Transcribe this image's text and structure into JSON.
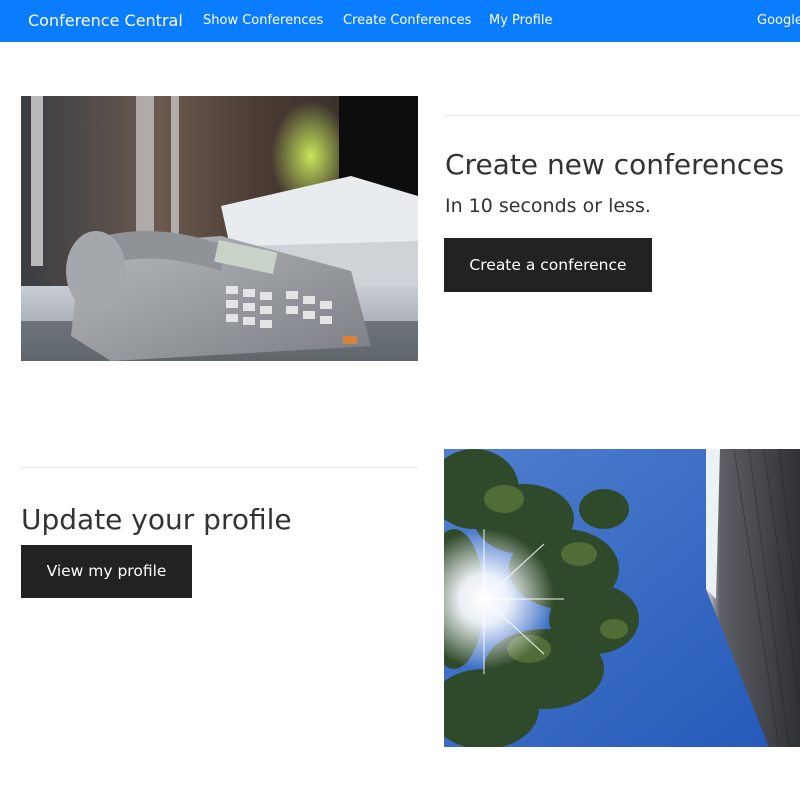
{
  "navbar": {
    "brand": "Conference Central",
    "links": [
      "Show Conferences",
      "Create Conferences",
      "My Profile"
    ],
    "signin_label": "Google",
    "background": "#0a7cff"
  },
  "section_create": {
    "title": "Create new conferences",
    "subtitle": "In 10 seconds or less.",
    "button_label": "Create a conference",
    "image_icon": "office-phone-photo"
  },
  "section_profile": {
    "title": "Update your profile",
    "button_label": "View my profile",
    "image_icon": "sky-tree-sun-photo"
  }
}
